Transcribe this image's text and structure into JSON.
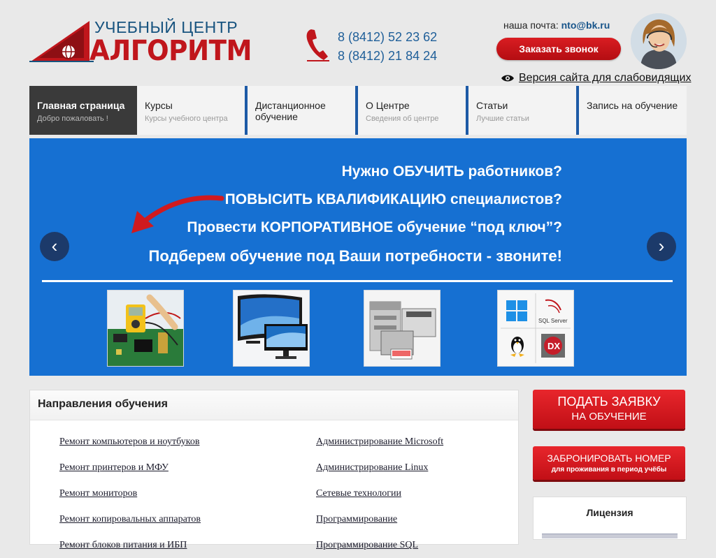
{
  "header": {
    "logo_line1": "УЧЕБНЫЙ ЦЕНТР",
    "logo_line2": "АЛГОРИТМ",
    "phones": [
      "8 (8412) 52 23 62",
      "8 (8412) 21 84 24"
    ],
    "mail_label": "наша почта:",
    "mail_address": "nto@bk.ru",
    "call_button": "Заказать звонок",
    "a11y_link": "Версия сайта для слабовидящих"
  },
  "nav": {
    "items": [
      {
        "title": "Главная страница",
        "sub": "Добро пожаловать !"
      },
      {
        "title": "Курсы",
        "sub": "Курсы учебного центра"
      },
      {
        "title": "Дистанционное обучение",
        "sub": ""
      },
      {
        "title": "О Центре",
        "sub": "Сведения об центре"
      },
      {
        "title": "Статьи",
        "sub": "Лучшие статьи"
      },
      {
        "title": "Запись на обучение",
        "sub": ""
      }
    ]
  },
  "banner": {
    "lines": [
      "Нужно ОБУЧИТЬ работников?",
      "ПОВЫСИТЬ КВАЛИФИКАЦИЮ специалистов?",
      "Провести КОРПОРАТИВНОЕ обучение “под ключ”?",
      "Подберем обучение под Ваши потребности - звоните!"
    ],
    "thumb_logo_text": "SQL Server",
    "thumb_dx_text": "DX"
  },
  "directions": {
    "title": "Направления обучения",
    "col1": [
      "Ремонт компьютеров и ноутбуков",
      "Ремонт принтеров и МФУ",
      "Ремонт мониторов",
      "Ремонт копировальных аппаратов",
      "Ремонт блоков питания и ИБП"
    ],
    "col2": [
      "Администрирование Microsoft",
      "Администрирование Linux",
      "Сетевые технологии",
      "Программирование",
      "Программирование SQL"
    ]
  },
  "sidebar": {
    "apply_line1": "ПОДАТЬ ЗАЯВКУ",
    "apply_line2": "НА ОБУЧЕНИЕ",
    "book_line1": "ЗАБРОНИРОВАТЬ НОМЕР",
    "book_line2": "для проживания в период учёбы",
    "license_title": "Лицензия"
  },
  "colors": {
    "brand_red": "#c0161c",
    "brand_blue": "#1670d2",
    "nav_accent": "#1d5aa6"
  }
}
